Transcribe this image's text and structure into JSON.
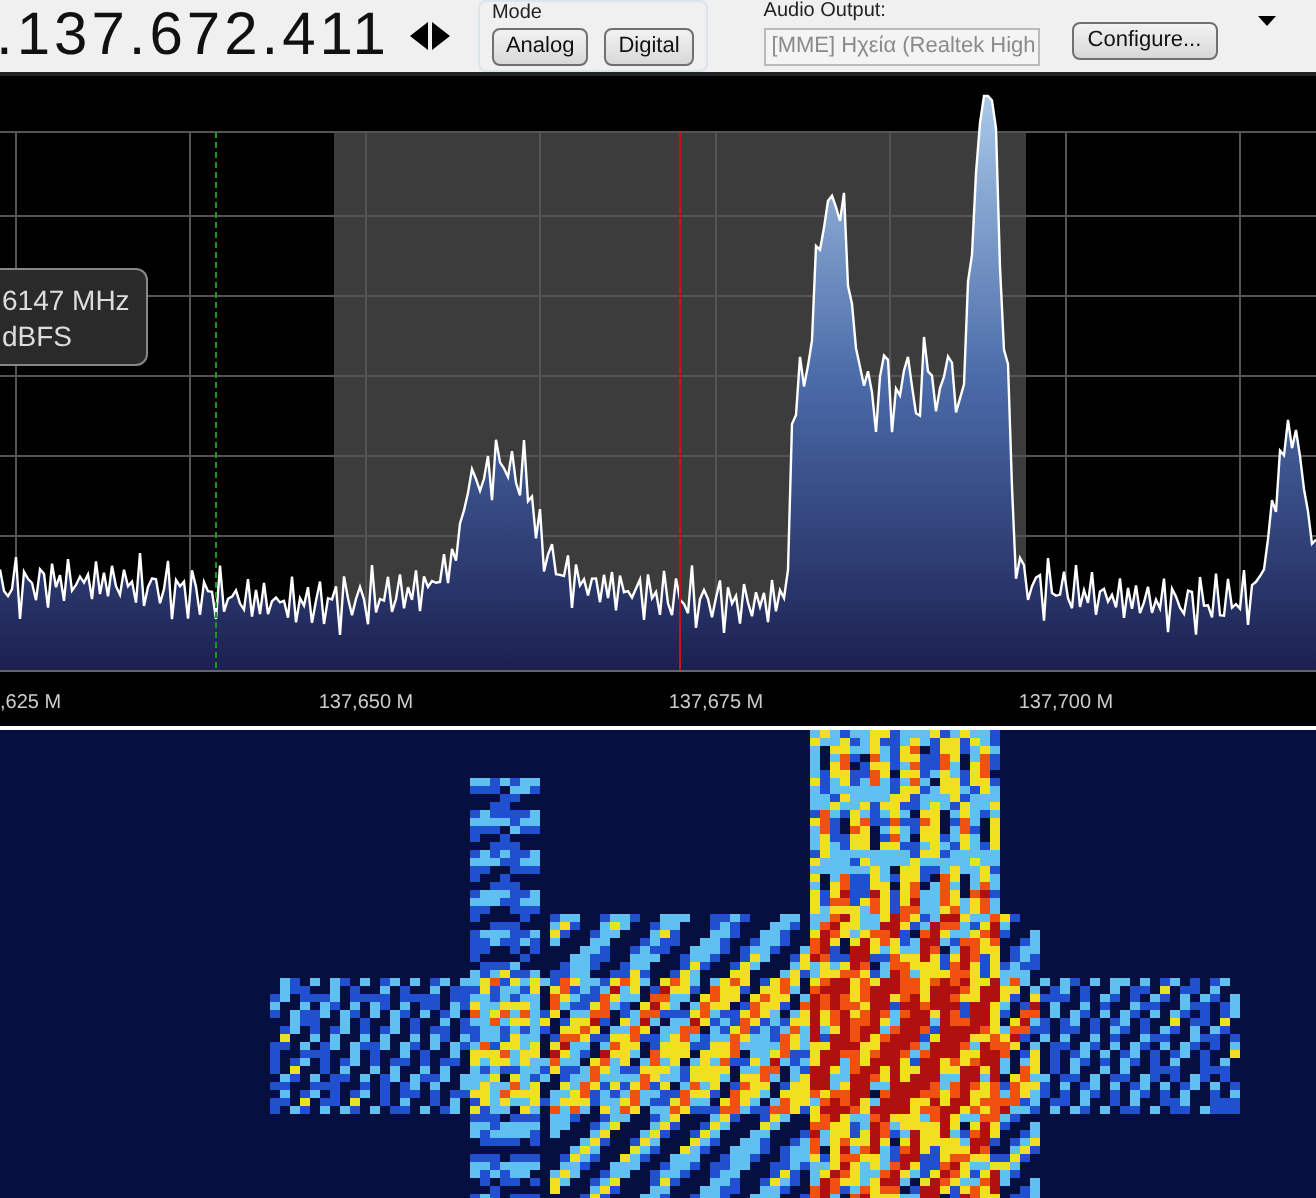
{
  "frequency": {
    "display": ".137.672.411"
  },
  "mode": {
    "label": "Mode",
    "buttons": [
      {
        "label": "Analog"
      },
      {
        "label": "Digital"
      }
    ]
  },
  "audio_output": {
    "label": "Audio Output:",
    "value": "[MME] Ηχεία (Realtek High",
    "disabled": true
  },
  "configure_button": {
    "label": "Configure..."
  },
  "spectrum": {
    "tooltip": [
      "6147 MHz",
      "dBFS"
    ],
    "axis_labels": [
      ",625 M",
      "137,650 M",
      "137,675 M",
      "137,700 M"
    ]
  }
}
